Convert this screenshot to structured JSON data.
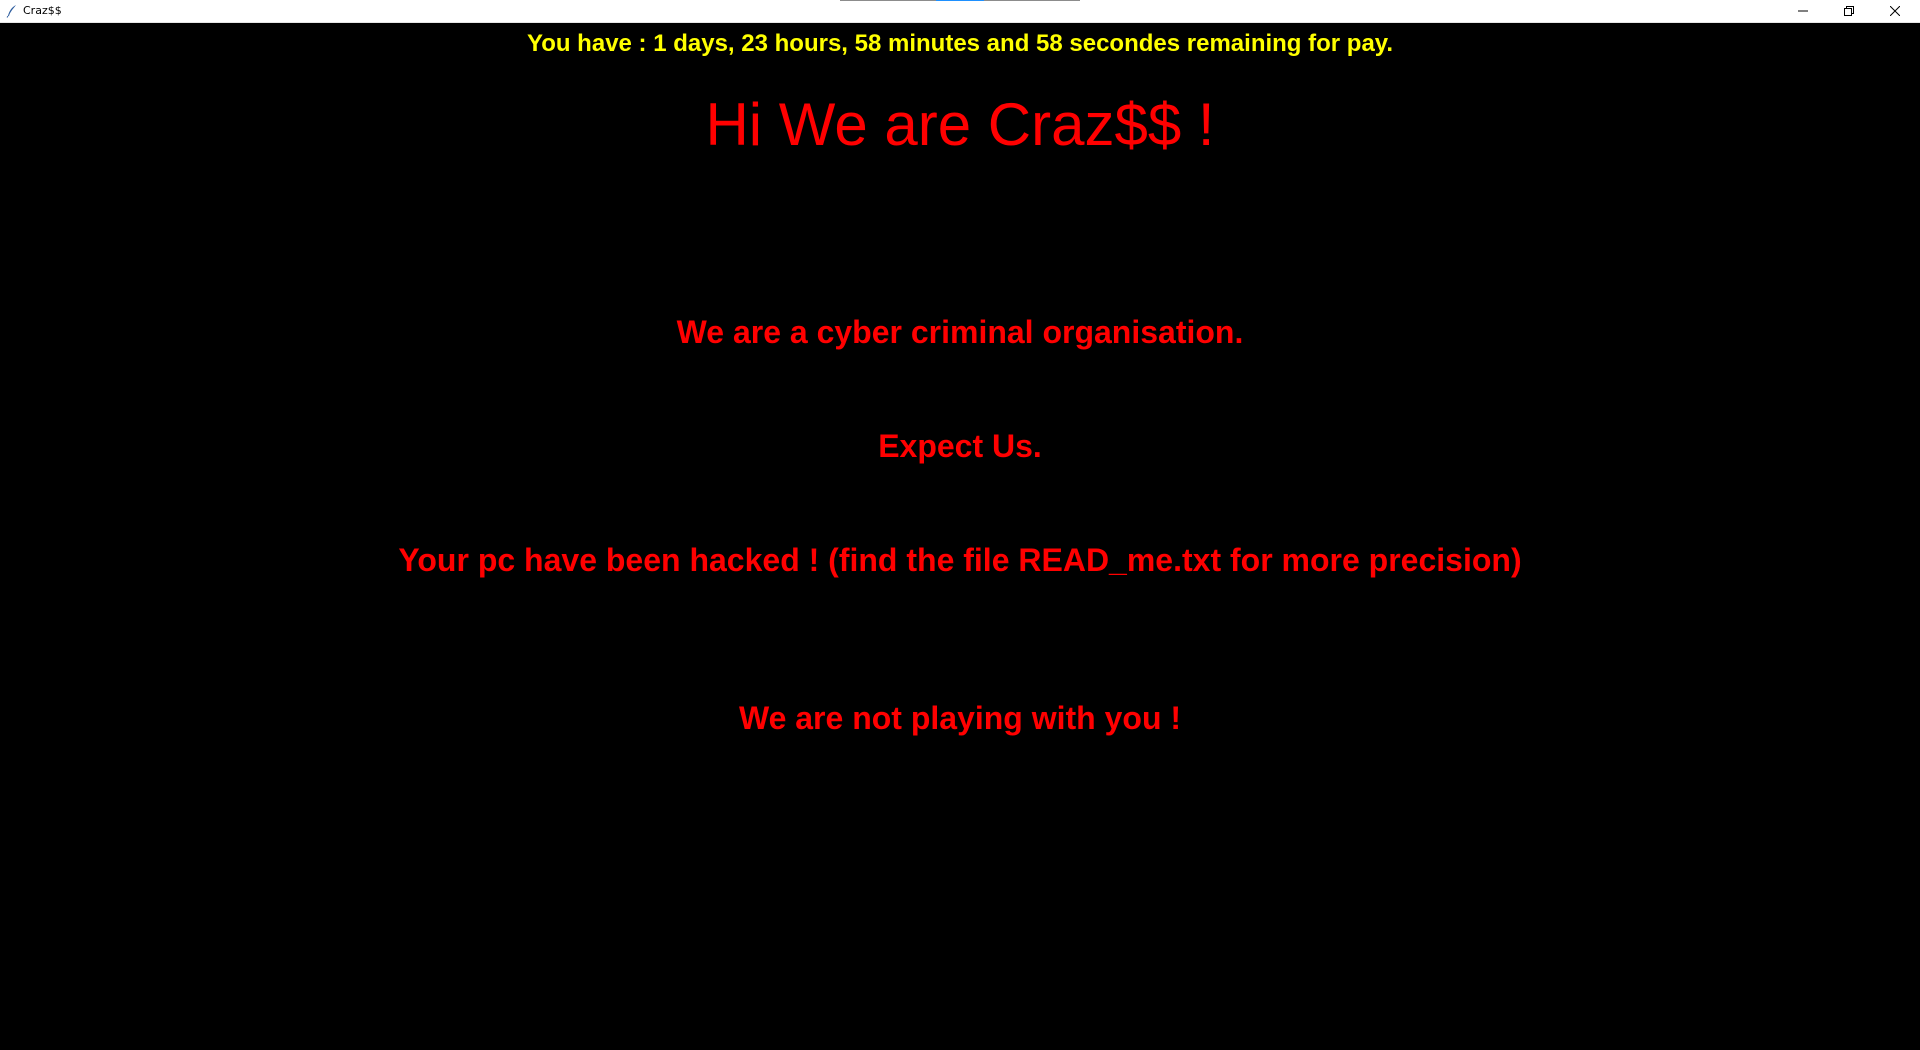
{
  "window": {
    "title": "Craz$$",
    "icon": "feather-icon",
    "controls": {
      "minimize_icon": "minimize-icon",
      "maximize_icon": "restore-icon",
      "close_icon": "close-icon"
    }
  },
  "content": {
    "countdown": "You have : 1 days, 23 hours, 58 minutes and 58 secondes remaining for pay.",
    "headline": "Hi We are Craz$$ !",
    "messages": [
      "We are a cyber criminal organisation.",
      "Expect Us.",
      "Your pc have been hacked ! (find the file READ_me.txt for more precision)",
      "We are not playing with you !"
    ]
  },
  "colors": {
    "background": "#000000",
    "countdown_text": "#ffff00",
    "message_text": "#ff0000",
    "titlebar": "#ffffff"
  }
}
